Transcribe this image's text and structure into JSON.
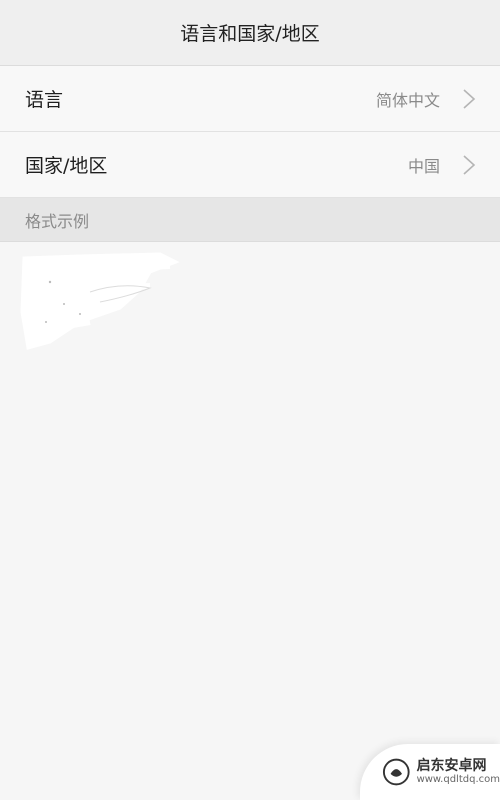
{
  "header": {
    "title": "语言和国家/地区"
  },
  "settings": {
    "rows": [
      {
        "label": "语言",
        "value": "简体中文",
        "icon": "chevron-right-icon"
      },
      {
        "label": "国家/地区",
        "value": "中国",
        "icon": "chevron-right-icon"
      }
    ]
  },
  "format_section": {
    "title": "格式示例"
  },
  "watermark": {
    "name": "启东安卓网",
    "url": "www.qdltdq.com",
    "icon": "site-logo-icon"
  },
  "colors": {
    "background": "#f6f6f6",
    "section_header": "#e6e6e6",
    "value_text": "#8a8a8a"
  }
}
